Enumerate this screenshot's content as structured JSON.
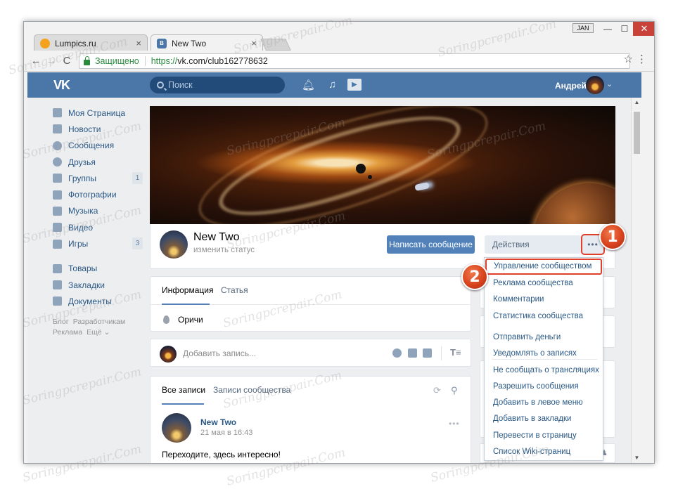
{
  "browser": {
    "tabs": [
      {
        "title": "Lumpics.ru",
        "close": "×",
        "active": false
      },
      {
        "title": "New Two",
        "close": "×",
        "active": true
      }
    ],
    "user_badge": "JAN",
    "controls": {
      "minimize": "—",
      "maximize": "☐",
      "close": "✕"
    },
    "nav": {
      "back": "←",
      "forward": "→",
      "reload": "C"
    },
    "secure_label": "Защищено",
    "url_scheme": "https://",
    "url_rest": "vk.com/club162778632",
    "star": "☆",
    "menu": "⋮"
  },
  "vk": {
    "logo": "VK",
    "search_placeholder": "Поиск",
    "header_icons": [
      "bell-icon",
      "music-note-icon",
      "play-icon"
    ],
    "user_name": "Андрей",
    "left_menu": [
      {
        "label": "Моя Страница",
        "icon": "home-icon"
      },
      {
        "label": "Новости",
        "icon": "news-icon"
      },
      {
        "label": "Сообщения",
        "icon": "messages-icon"
      },
      {
        "label": "Друзья",
        "icon": "friends-icon"
      },
      {
        "label": "Группы",
        "icon": "groups-icon",
        "count": "1"
      },
      {
        "label": "Фотографии",
        "icon": "camera-icon"
      },
      {
        "label": "Музыка",
        "icon": "music-icon"
      },
      {
        "label": "Видео",
        "icon": "video-icon"
      },
      {
        "label": "Игры",
        "icon": "games-icon",
        "count": "3"
      },
      {
        "label": "Товары",
        "icon": "bag-icon"
      },
      {
        "label": "Закладки",
        "icon": "star-icon"
      },
      {
        "label": "Документы",
        "icon": "document-icon"
      }
    ],
    "footer_links": [
      "Блог",
      "Разработчикам",
      "Реклама",
      "Ещё ⌄"
    ],
    "group": {
      "name": "New Two",
      "status": "изменить статус",
      "write_button": "Написать сообщение",
      "actions_button": "Действия",
      "more_button": "•••"
    },
    "info_tabs": [
      "Информация",
      "Статья"
    ],
    "location": "Оричи",
    "post_box_placeholder": "Добавить запись...",
    "post_box_format": "T≡",
    "wall_tabs": [
      "Все записи",
      "Записи сообщества"
    ],
    "post": {
      "author": "New Two",
      "date": "21 мая в 16:43",
      "text": "Переходите, здесь интересно!",
      "more": "•••"
    },
    "members_count": "1 ♟",
    "dropdown": [
      "Управление сообществом",
      "Реклама сообщества",
      "Комментарии",
      "Статистика сообщества",
      "Отправить деньги",
      "Уведомлять о записях",
      "Не сообщать о трансляциях",
      "Разрешить сообщения",
      "Добавить в левое меню",
      "Добавить в закладки",
      "Перевести в страницу",
      "Список Wiki-страниц"
    ]
  },
  "steps": [
    "1",
    "2"
  ],
  "watermark": "Soringpcrepair.Com",
  "colors": {
    "vk_blue": "#4a76a8",
    "link": "#2a5885",
    "highlight": "#e0402a",
    "button": "#5181b8"
  }
}
